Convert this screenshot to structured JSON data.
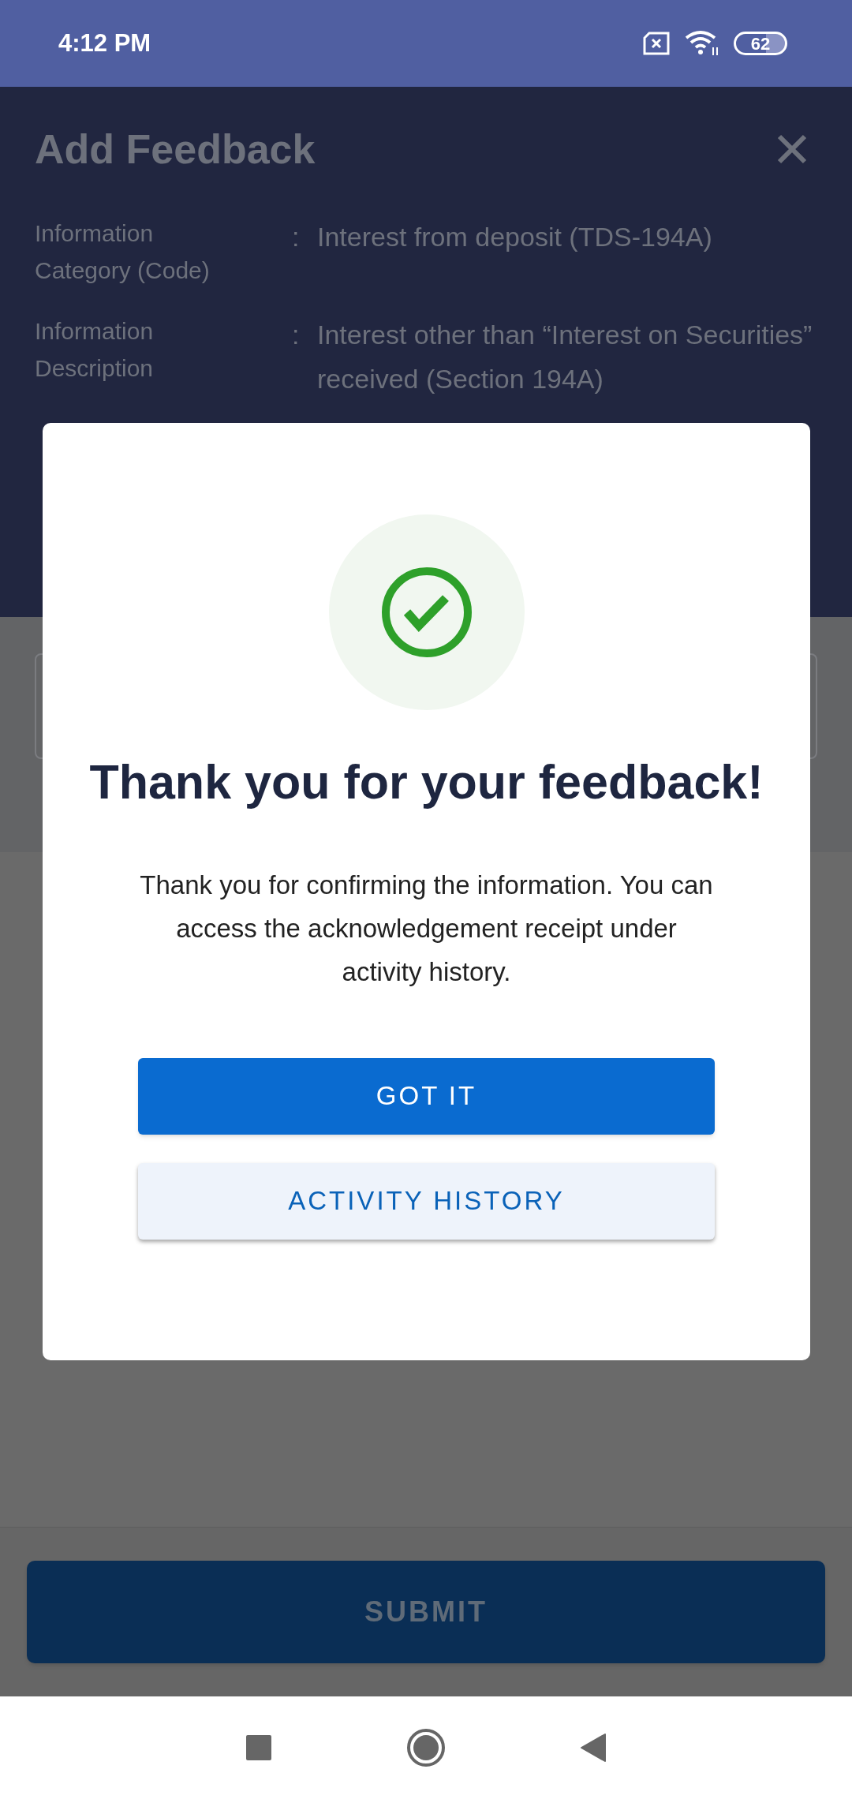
{
  "status_bar": {
    "time": "4:12 PM",
    "battery": "62"
  },
  "header": {
    "title": "Add Feedback",
    "fields": [
      {
        "label": "Information Category (Code)",
        "separator": ":",
        "value": "Interest from deposit (TDS-194A)"
      },
      {
        "label": "Information Description",
        "separator": ":",
        "value": "Interest other than “Interest on Securities” received (Section 194A)"
      }
    ]
  },
  "dialog": {
    "title": "Thank you for your feedback!",
    "message": "Thank you for confirming the information. You can access the acknowledgement receipt under activity history.",
    "buttons": [
      {
        "label": "GOT IT",
        "kind": "primary"
      },
      {
        "label": "ACTIVITY HISTORY",
        "kind": "secondary"
      }
    ]
  },
  "footer": {
    "submit": "SUBMIT"
  }
}
